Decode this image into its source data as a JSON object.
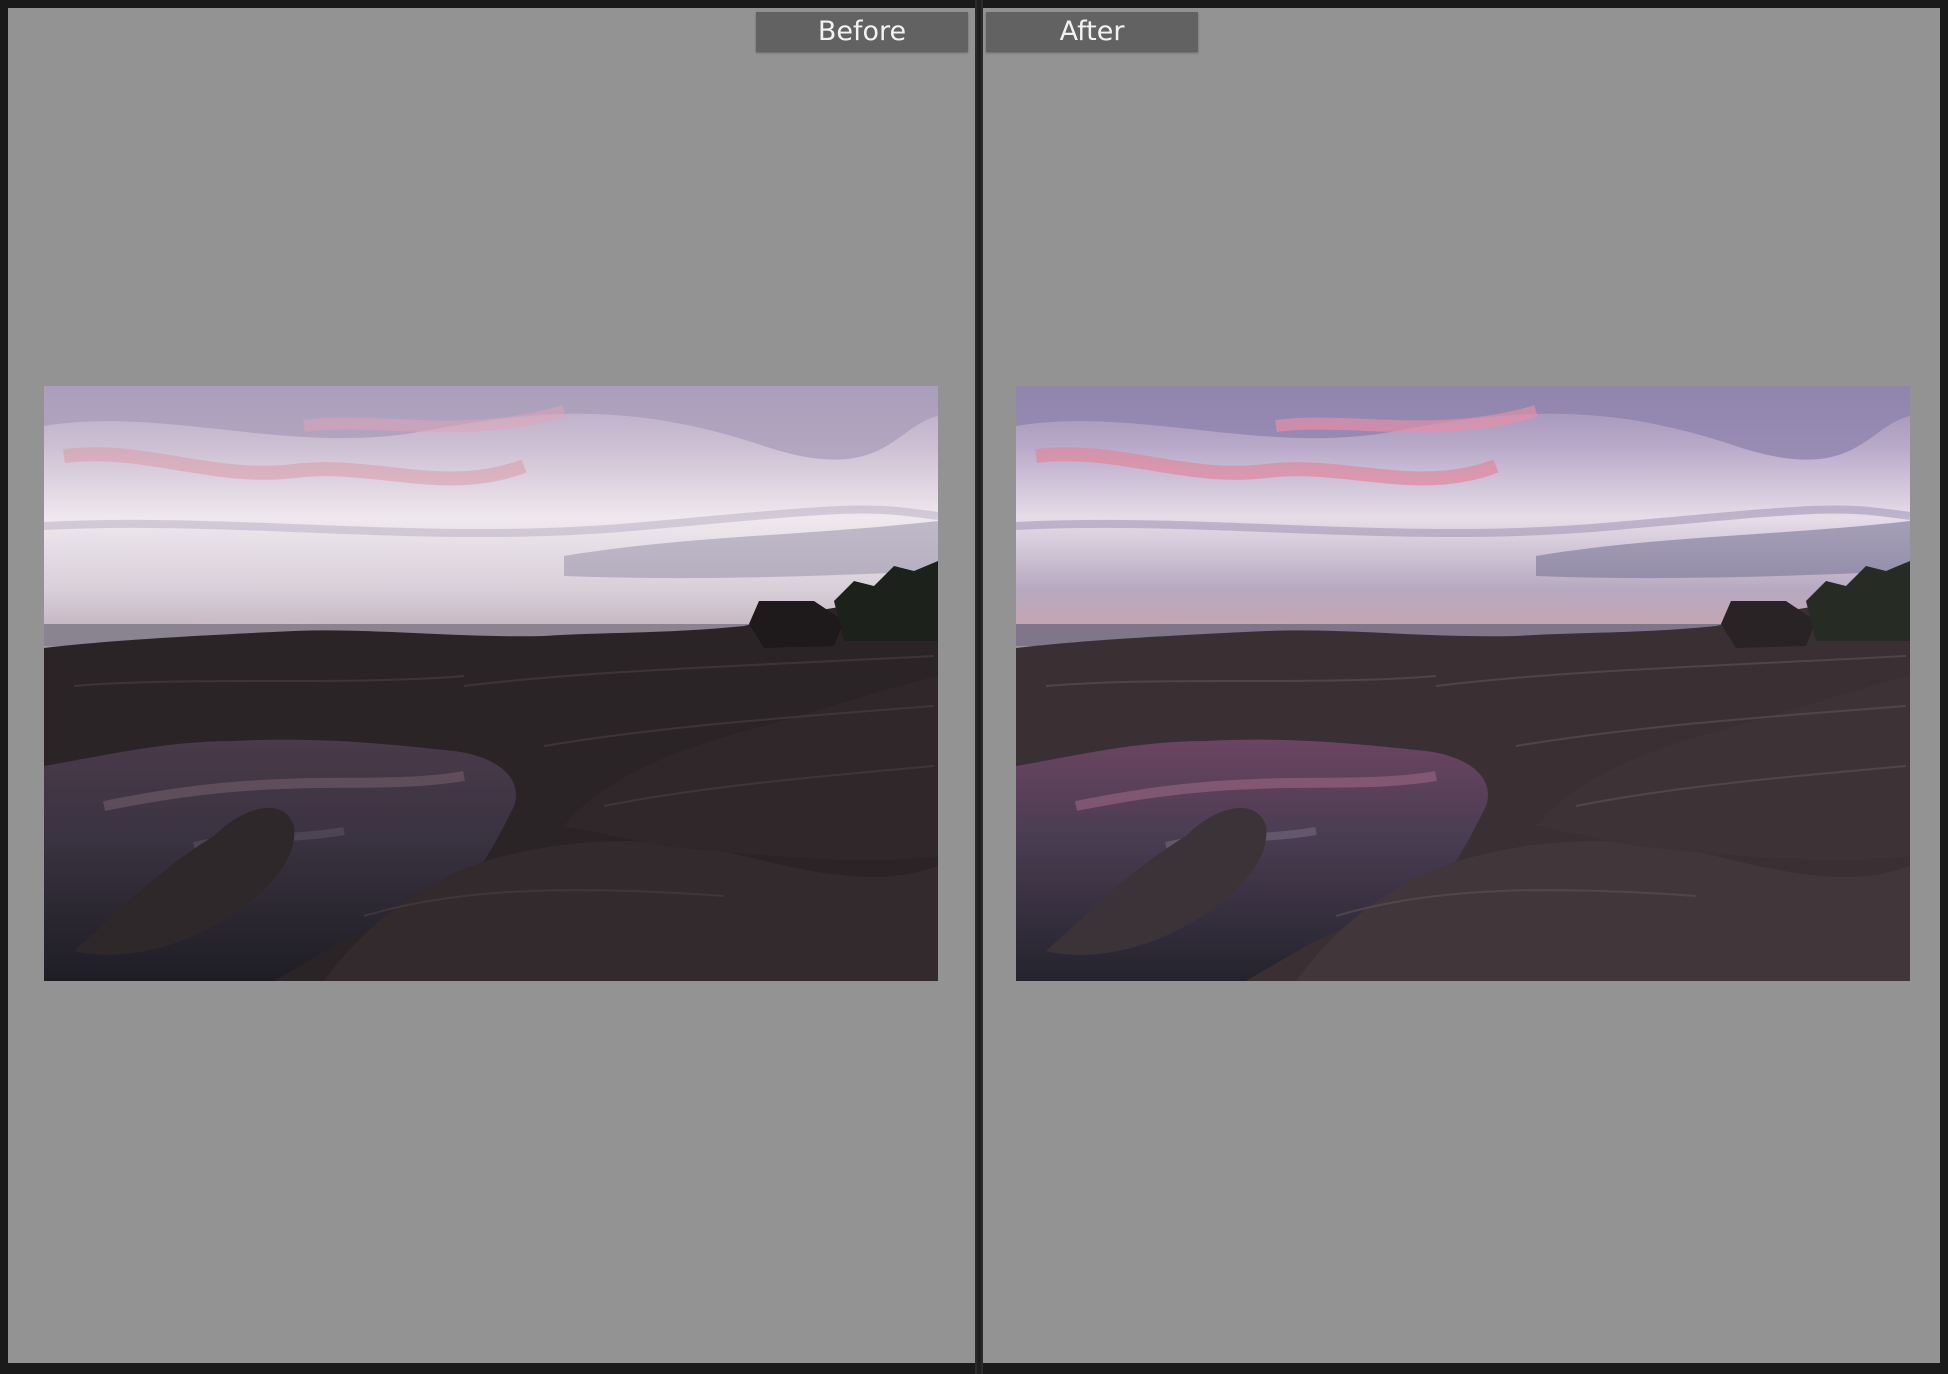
{
  "compare_view": {
    "before": {
      "label": "Before"
    },
    "after": {
      "label": "After"
    }
  },
  "colors": {
    "pane_background": "#939393",
    "label_background": "#626262",
    "label_text": "#f2f2f2",
    "frame": "#1a1a1a"
  }
}
